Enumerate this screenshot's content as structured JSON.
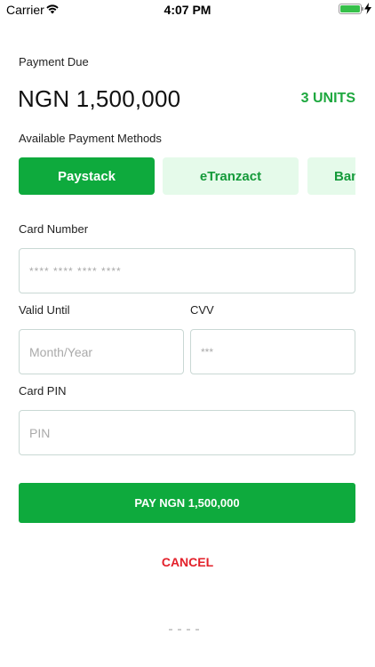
{
  "status_bar": {
    "carrier": "Carrier",
    "time": "4:07 PM",
    "battery_level": 1.0
  },
  "payment": {
    "due_label": "Payment Due",
    "amount": "NGN 1,500,000",
    "units": "3 UNITS"
  },
  "methods": {
    "label": "Available Payment Methods",
    "items": [
      {
        "label": "Paystack",
        "selected": true
      },
      {
        "label": "eTranzact",
        "selected": false
      },
      {
        "label": "Bank Transfer",
        "selected": false
      }
    ]
  },
  "form": {
    "card_number_label": "Card Number",
    "card_number_placeholder": "**** **** **** ****",
    "valid_until_label": "Valid Until",
    "valid_until_placeholder": "Month/Year",
    "cvv_label": "CVV",
    "cvv_placeholder": "***",
    "pin_label": "Card PIN",
    "pin_placeholder": "PIN"
  },
  "actions": {
    "pay_label": "PAY NGN 1,500,000",
    "cancel_label": "CANCEL"
  },
  "colors": {
    "primary_green": "#0eaa3d",
    "light_green": "#e5faea",
    "cancel_red": "#e3202a",
    "field_border": "#c9d8d4"
  }
}
